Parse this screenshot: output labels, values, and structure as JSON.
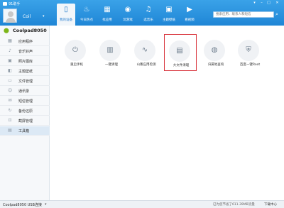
{
  "app": {
    "title": "91助手"
  },
  "header": {
    "username": "Coil",
    "tabs": [
      {
        "label": "我的设备",
        "icon": "phone-icon"
      },
      {
        "label": "今日热点",
        "icon": "flame-icon"
      },
      {
        "label": "找应用",
        "icon": "grid-icon"
      },
      {
        "label": "玩游戏",
        "icon": "gamepad-icon"
      },
      {
        "label": "选音乐",
        "icon": "music-note-icon"
      },
      {
        "label": "主题壁纸",
        "icon": "picture-icon"
      },
      {
        "label": "看视频",
        "icon": "video-icon"
      }
    ],
    "search_placeholder": "搜索应用、联系人和短信"
  },
  "sidebar": {
    "device_name": "Coolpad8050",
    "items": [
      {
        "label": "应用程序",
        "icon": "apps-icon"
      },
      {
        "label": "音乐铃声",
        "icon": "music-icon"
      },
      {
        "label": "照片图库",
        "icon": "photo-icon"
      },
      {
        "label": "主题壁纸",
        "icon": "theme-icon"
      },
      {
        "label": "文件管理",
        "icon": "folder-icon"
      },
      {
        "label": "通讯录",
        "icon": "contacts-icon"
      },
      {
        "label": "短信管理",
        "icon": "sms-icon"
      },
      {
        "label": "备份还原",
        "icon": "backup-icon"
      },
      {
        "label": "截屏管理",
        "icon": "screenshot-icon"
      },
      {
        "label": "工具箱",
        "icon": "toolbox-icon"
      }
    ],
    "active_index": 9
  },
  "tools": [
    {
      "label": "重启手机",
      "icon": "power-icon"
    },
    {
      "label": "一键清理",
      "icon": "trash-icon"
    },
    {
      "label": "山寨应用检测",
      "icon": "pulse-icon"
    },
    {
      "label": "大文件清理",
      "icon": "file-clean-icon"
    },
    {
      "label": "归属地查询",
      "icon": "globe-icon"
    },
    {
      "label": "百度一键Root",
      "icon": "shield-icon"
    }
  ],
  "status": {
    "connection": "Coolpad8050 USB连接",
    "saved": "已为您节省了611.39MB流量",
    "download": "下载中心"
  },
  "colors": {
    "header_blue": "#2a8ee0",
    "highlight_red": "#d9363e",
    "active_item": "#dce9f5"
  }
}
